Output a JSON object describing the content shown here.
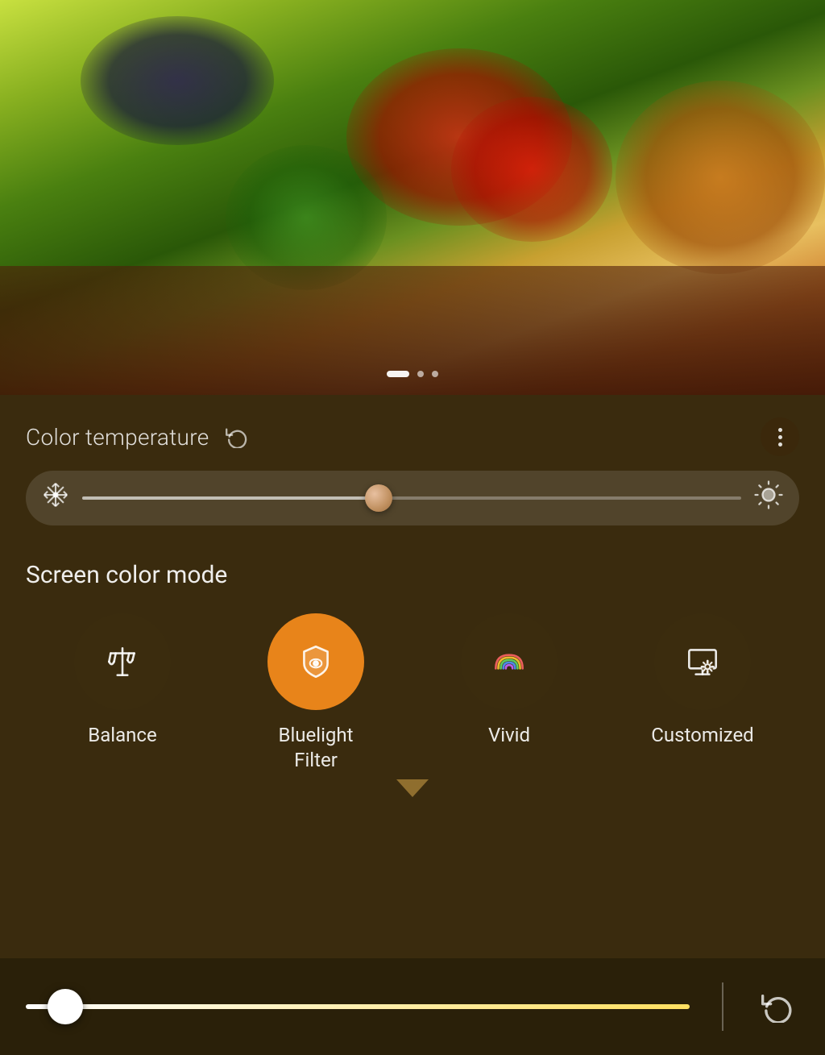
{
  "hero": {
    "page_indicators": [
      {
        "type": "active"
      },
      {
        "type": "inactive"
      },
      {
        "type": "inactive"
      }
    ]
  },
  "color_temperature": {
    "title": "Color temperature",
    "refresh_icon": "refresh-icon",
    "more_icon": "more-options-icon",
    "slider": {
      "cold_icon": "❄",
      "warm_icon": "☀",
      "value_percent": 45
    }
  },
  "screen_color_mode": {
    "title": "Screen color mode",
    "modes": [
      {
        "id": "balance",
        "label": "Balance",
        "active": false,
        "icon": "balance-scale"
      },
      {
        "id": "bluelight",
        "label": "Bluelight\nFilter",
        "label_line1": "Bluelight",
        "label_line2": "Filter",
        "active": true,
        "icon": "shield-eye"
      },
      {
        "id": "vivid",
        "label": "Vivid",
        "active": false,
        "icon": "rainbow"
      },
      {
        "id": "customized",
        "label": "Customized",
        "active": false,
        "icon": "display-settings"
      }
    ]
  },
  "brightness": {
    "value_percent": 6,
    "reset_icon": "refresh-icon"
  }
}
